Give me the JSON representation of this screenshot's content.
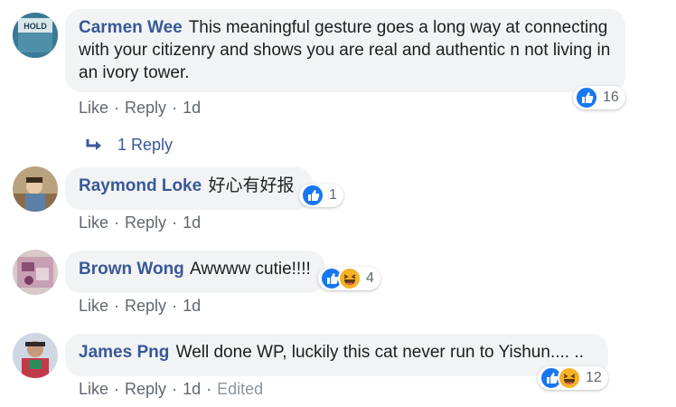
{
  "actions": {
    "like": "Like",
    "reply": "Reply",
    "separator": "·"
  },
  "colors": {
    "author": "#385898",
    "meta": "#606770",
    "bubble": "#f2f3f5",
    "like": "#1877f2",
    "haha": "#f7b125"
  },
  "comments": [
    {
      "author": "Carmen Wee",
      "text": "This meaningful gesture goes a long way at connecting with your citizenry and shows you are real and authentic n not living in an ivory tower.",
      "time": "1d",
      "reactions": [
        "like-icon"
      ],
      "reaction_count": "16",
      "avatar_text": "HOLD"
    },
    {
      "author": "Raymond Loke",
      "text": "好心有好报",
      "time": "1d",
      "reactions": [
        "like-icon"
      ],
      "reaction_count": "1"
    },
    {
      "author": "Brown Wong",
      "text": "Awwww cutie!!!!",
      "time": "1d",
      "reactions": [
        "like-icon",
        "haha-icon"
      ],
      "reaction_count": "4"
    },
    {
      "author": "James Png",
      "text": "Well done WP, luckily this cat never run to Yishun.... ..",
      "time": "1d",
      "edited": "Edited",
      "reactions": [
        "like-icon",
        "haha-icon"
      ],
      "reaction_count": "12"
    }
  ],
  "replies_link": {
    "label": "1 Reply",
    "icon": "reply-arrow-icon"
  }
}
